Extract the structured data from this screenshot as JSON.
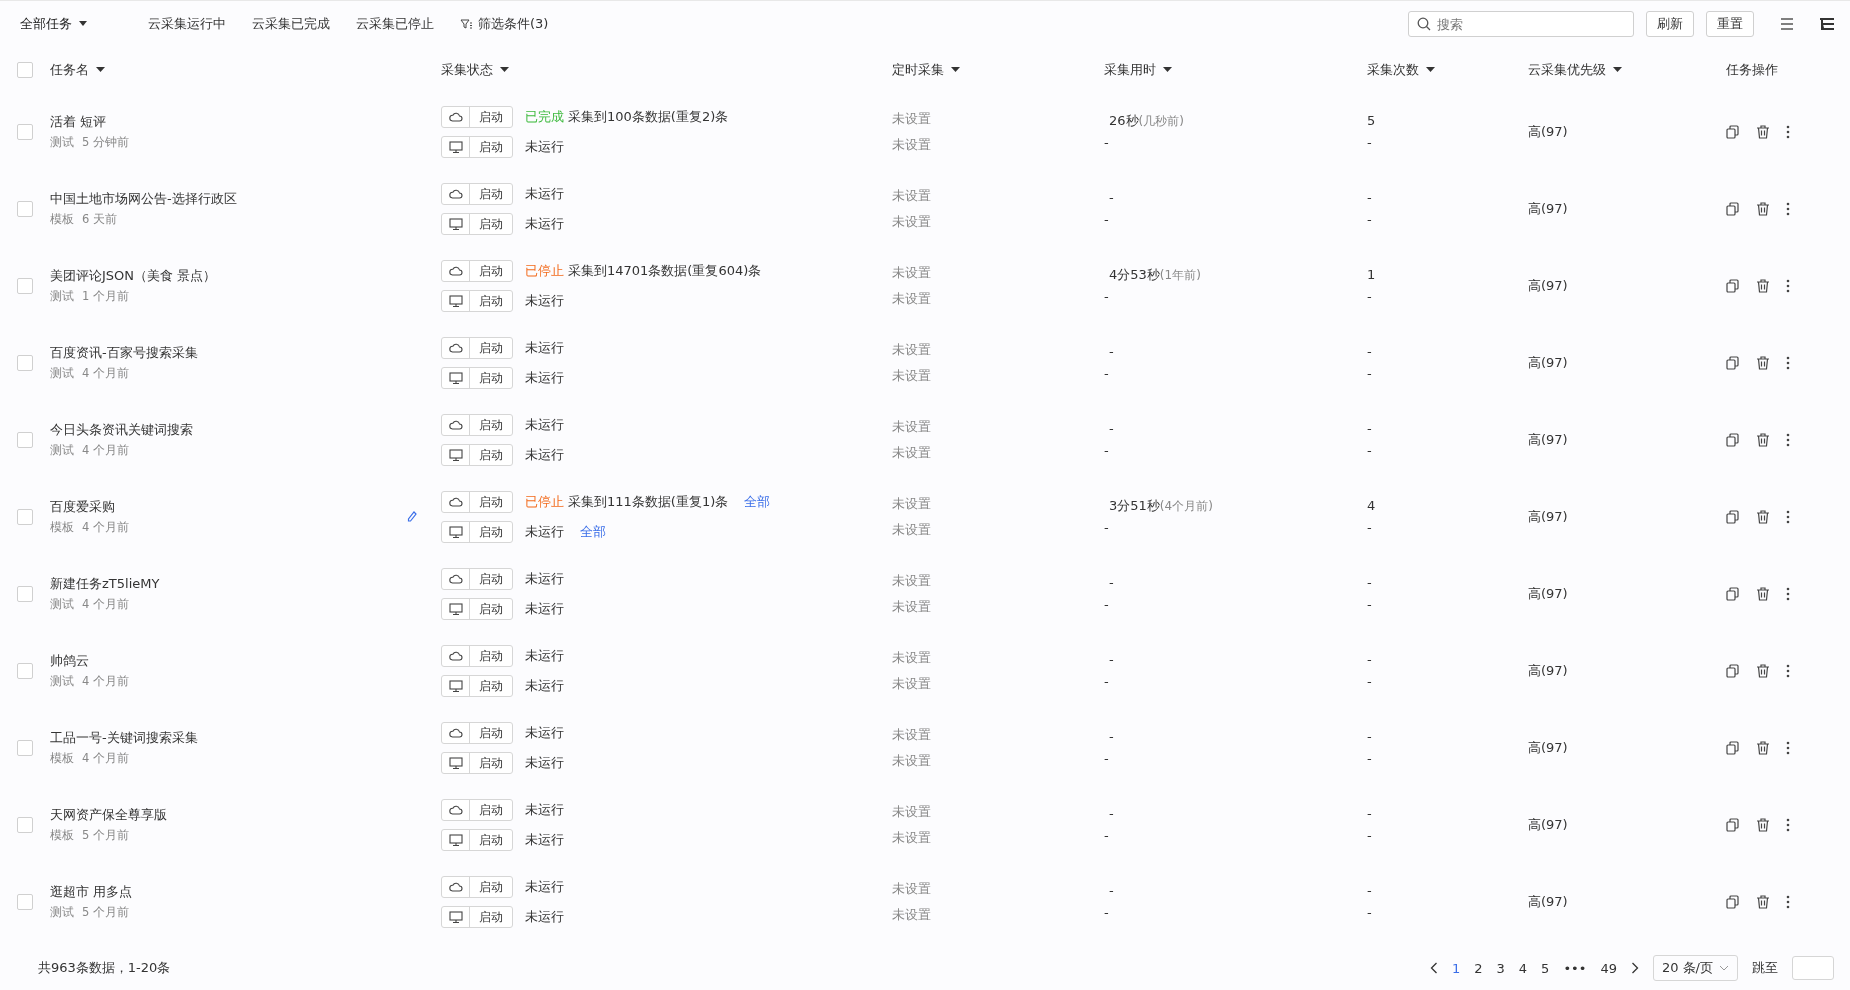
{
  "toolbar": {
    "filters": [
      {
        "label": "全部任务",
        "kind": "dropdown",
        "selected": true
      },
      {
        "label": "云采集运行中",
        "kind": "plain",
        "selected": false
      },
      {
        "label": "云采集已完成",
        "kind": "plain",
        "selected": false
      },
      {
        "label": "云采集已停止",
        "kind": "plain",
        "selected": false
      },
      {
        "label": "筛选条件(3)",
        "kind": "filter",
        "selected": false
      }
    ],
    "search": {
      "placeholder": "搜索"
    },
    "buttons": [
      "刷新",
      "重置"
    ]
  },
  "table": {
    "select_all": {
      "checked": false
    },
    "columns": [
      {
        "label": "任务名",
        "sortable": true
      },
      {
        "label": "采集状态",
        "sortable": true
      },
      {
        "label": "定时采集",
        "sortable": true
      },
      {
        "label": "采集用时",
        "sortable": true
      },
      {
        "label": "采集次数",
        "sortable": true
      },
      {
        "label": "云采集优先级",
        "sortable": true
      },
      {
        "label": "任务操作",
        "sortable": false
      }
    ],
    "rows": [
      {
        "name": "活着 短评",
        "tag": "测试",
        "time": "5 分钟前",
        "checked": false,
        "cloud": {
          "button": "启动",
          "kind": "done",
          "status": "已完成",
          "detail": "采集到100条数据(重复2)条"
        },
        "local": {
          "button": "启动",
          "kind": "idle",
          "status": "未运行"
        },
        "schedule": [
          "未设置",
          "未设置"
        ],
        "duration": [
          {
            "value": "26秒",
            "ago": "(几秒前)"
          },
          {
            "value": "-"
          }
        ],
        "count": [
          "5",
          "-"
        ],
        "priority": "高(97)"
      },
      {
        "name": "中国土地市场网公告-选择行政区",
        "tag": "模板",
        "time": "6 天前",
        "checked": false,
        "cloud": {
          "button": "启动",
          "kind": "idle",
          "status": "未运行"
        },
        "local": {
          "button": "启动",
          "kind": "idle",
          "status": "未运行"
        },
        "schedule": [
          "未设置",
          "未设置"
        ],
        "duration": [
          {
            "value": "-"
          },
          {
            "value": "-"
          }
        ],
        "count": [
          "-",
          "-"
        ],
        "priority": "高(97)"
      },
      {
        "name": "美团评论JSON（美食 景点）",
        "tag": "测试",
        "time": "1 个月前",
        "checked": false,
        "cloud": {
          "button": "启动",
          "kind": "stopped",
          "status": "已停止",
          "detail": "采集到14701条数据(重复604)条"
        },
        "local": {
          "button": "启动",
          "kind": "idle",
          "status": "未运行"
        },
        "schedule": [
          "未设置",
          "未设置"
        ],
        "duration": [
          {
            "value": "4分53秒",
            "ago": "(1年前)"
          },
          {
            "value": "-"
          }
        ],
        "count": [
          "1",
          "-"
        ],
        "priority": "高(97)"
      },
      {
        "name": "百度资讯-百家号搜索采集",
        "tag": "测试",
        "time": "4 个月前",
        "checked": false,
        "cloud": {
          "button": "启动",
          "kind": "idle",
          "status": "未运行"
        },
        "local": {
          "button": "启动",
          "kind": "idle",
          "status": "未运行"
        },
        "schedule": [
          "未设置",
          "未设置"
        ],
        "duration": [
          {
            "value": "-"
          },
          {
            "value": "-"
          }
        ],
        "count": [
          "-",
          "-"
        ],
        "priority": "高(97)"
      },
      {
        "name": "今日头条资讯关键词搜索",
        "tag": "测试",
        "time": "4 个月前",
        "checked": false,
        "cloud": {
          "button": "启动",
          "kind": "idle",
          "status": "未运行"
        },
        "local": {
          "button": "启动",
          "kind": "idle",
          "status": "未运行"
        },
        "schedule": [
          "未设置",
          "未设置"
        ],
        "duration": [
          {
            "value": "-"
          },
          {
            "value": "-"
          }
        ],
        "count": [
          "-",
          "-"
        ],
        "priority": "高(97)"
      },
      {
        "name": "百度爱采购",
        "tag": "模板",
        "time": "4 个月前",
        "checked": false,
        "edit_icon": true,
        "cloud": {
          "button": "启动",
          "kind": "stopped",
          "status": "已停止",
          "detail": "采集到111条数据(重复1)条",
          "link": "全部"
        },
        "local": {
          "button": "启动",
          "kind": "idle",
          "status": "未运行",
          "link": "全部"
        },
        "schedule": [
          "未设置",
          "未设置"
        ],
        "duration": [
          {
            "value": "3分51秒",
            "ago": "(4个月前)"
          },
          {
            "value": "-"
          }
        ],
        "count": [
          "4",
          "-"
        ],
        "priority": "高(97)"
      },
      {
        "name": "新建任务zT5lieMY",
        "tag": "测试",
        "time": "4 个月前",
        "checked": false,
        "cloud": {
          "button": "启动",
          "kind": "idle",
          "status": "未运行"
        },
        "local": {
          "button": "启动",
          "kind": "idle",
          "status": "未运行"
        },
        "schedule": [
          "未设置",
          "未设置"
        ],
        "duration": [
          {
            "value": "-"
          },
          {
            "value": "-"
          }
        ],
        "count": [
          "-",
          "-"
        ],
        "priority": "高(97)"
      },
      {
        "name": "帅鸽云",
        "tag": "测试",
        "time": "4 个月前",
        "checked": false,
        "cloud": {
          "button": "启动",
          "kind": "idle",
          "status": "未运行"
        },
        "local": {
          "button": "启动",
          "kind": "idle",
          "status": "未运行"
        },
        "schedule": [
          "未设置",
          "未设置"
        ],
        "duration": [
          {
            "value": "-"
          },
          {
            "value": "-"
          }
        ],
        "count": [
          "-",
          "-"
        ],
        "priority": "高(97)"
      },
      {
        "name": "工品一号-关键词搜索采集",
        "tag": "模板",
        "time": "4 个月前",
        "checked": false,
        "cloud": {
          "button": "启动",
          "kind": "idle",
          "status": "未运行"
        },
        "local": {
          "button": "启动",
          "kind": "idle",
          "status": "未运行"
        },
        "schedule": [
          "未设置",
          "未设置"
        ],
        "duration": [
          {
            "value": "-"
          },
          {
            "value": "-"
          }
        ],
        "count": [
          "-",
          "-"
        ],
        "priority": "高(97)"
      },
      {
        "name": "天网资产保全尊享版",
        "tag": "模板",
        "time": "5 个月前",
        "checked": false,
        "cloud": {
          "button": "启动",
          "kind": "idle",
          "status": "未运行"
        },
        "local": {
          "button": "启动",
          "kind": "idle",
          "status": "未运行"
        },
        "schedule": [
          "未设置",
          "未设置"
        ],
        "duration": [
          {
            "value": "-"
          },
          {
            "value": "-"
          }
        ],
        "count": [
          "-",
          "-"
        ],
        "priority": "高(97)"
      },
      {
        "name": "逛超市 用多点",
        "tag": "测试",
        "time": "5 个月前",
        "checked": false,
        "cloud": {
          "button": "启动",
          "kind": "idle",
          "status": "未运行"
        },
        "local": {
          "button": "启动",
          "kind": "idle",
          "status": "未运行"
        },
        "schedule": [
          "未设置",
          "未设置"
        ],
        "duration": [
          {
            "value": "-"
          },
          {
            "value": "-"
          }
        ],
        "count": [
          "-",
          "-"
        ],
        "priority": "高(97)"
      }
    ]
  },
  "footer": {
    "summary": "共963条数据，1-20条",
    "pages": [
      {
        "label": "1",
        "selected": true
      },
      {
        "label": "2",
        "selected": false
      },
      {
        "label": "3",
        "selected": false
      },
      {
        "label": "4",
        "selected": false
      },
      {
        "label": "5",
        "selected": false
      },
      {
        "label": "•••",
        "selected": false
      },
      {
        "label": "49",
        "selected": false
      }
    ],
    "page_size": "20 条/页",
    "jump_label": "跳至"
  }
}
